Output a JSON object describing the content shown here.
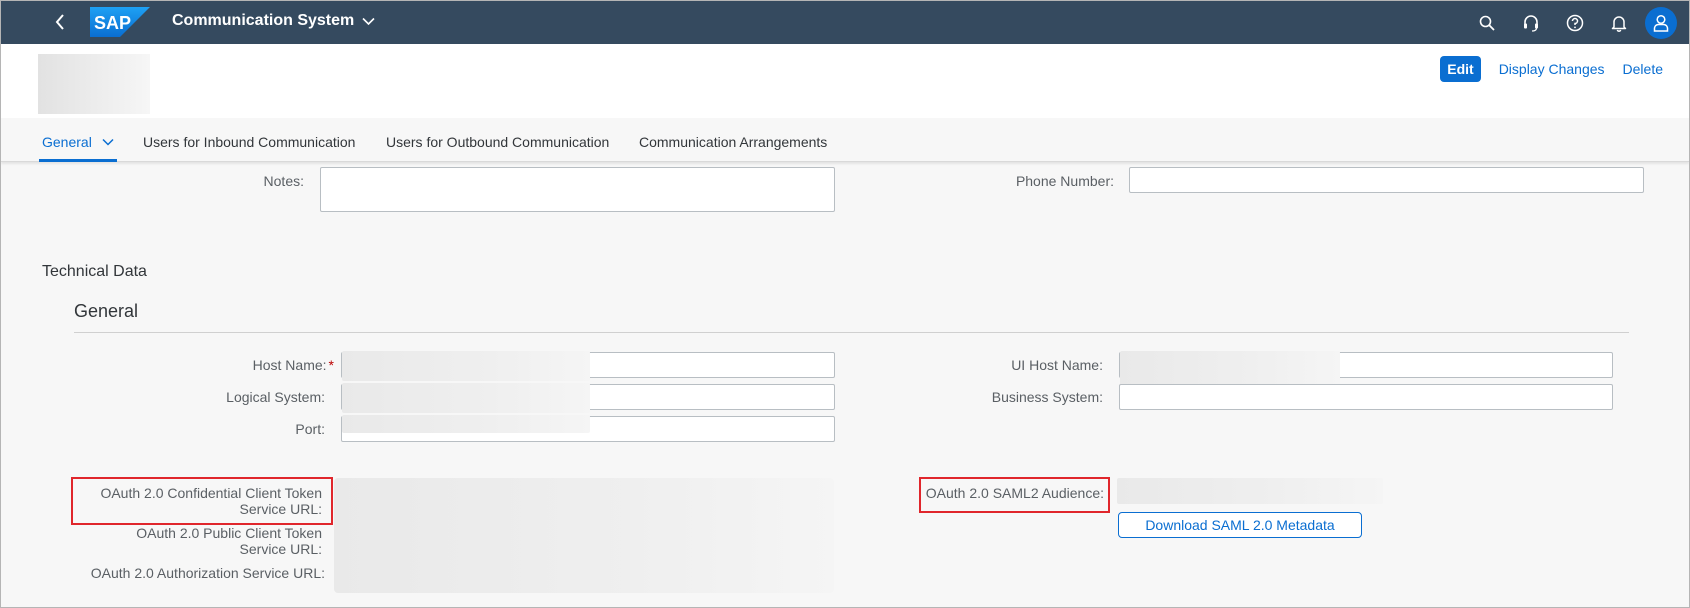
{
  "shell": {
    "logo_text": "SAP",
    "title": "Communication System",
    "icons": [
      "search-icon",
      "headset-icon",
      "help-icon",
      "bell-icon",
      "user-icon"
    ],
    "brand_color": "#354a5f",
    "accent_color": "#0a6ed1"
  },
  "header": {
    "actions": {
      "edit": "Edit",
      "display_changes": "Display Changes",
      "delete": "Delete"
    }
  },
  "tabs": [
    {
      "label": "General",
      "active": true
    },
    {
      "label": "Users for Inbound Communication",
      "active": false
    },
    {
      "label": "Users for Outbound Communication",
      "active": false
    },
    {
      "label": "Communication Arrangements",
      "active": false
    }
  ],
  "form": {
    "notes_label": "Notes:",
    "notes_value": "",
    "phone_label": "Phone Number:",
    "phone_value": ""
  },
  "technical": {
    "section_title": "Technical Data",
    "subsection_title": "General",
    "host_name_label": "Host Name:",
    "host_name_required": "*",
    "logical_system_label": "Logical System:",
    "port_label": "Port:",
    "ui_host_name_label": "UI Host Name:",
    "business_system_label": "Business System:",
    "oauth_confidential_label_1": "OAuth 2.0 Confidential Client Token",
    "oauth_confidential_label_2": "Service URL:",
    "oauth_public_label_1": "OAuth 2.0 Public Client Token",
    "oauth_public_label_2": "Service URL:",
    "oauth_authorization_label": "OAuth 2.0 Authorization Service URL:",
    "saml_audience_label": "OAuth 2.0 SAML2 Audience:",
    "download_button": "Download SAML 2.0 Metadata"
  }
}
